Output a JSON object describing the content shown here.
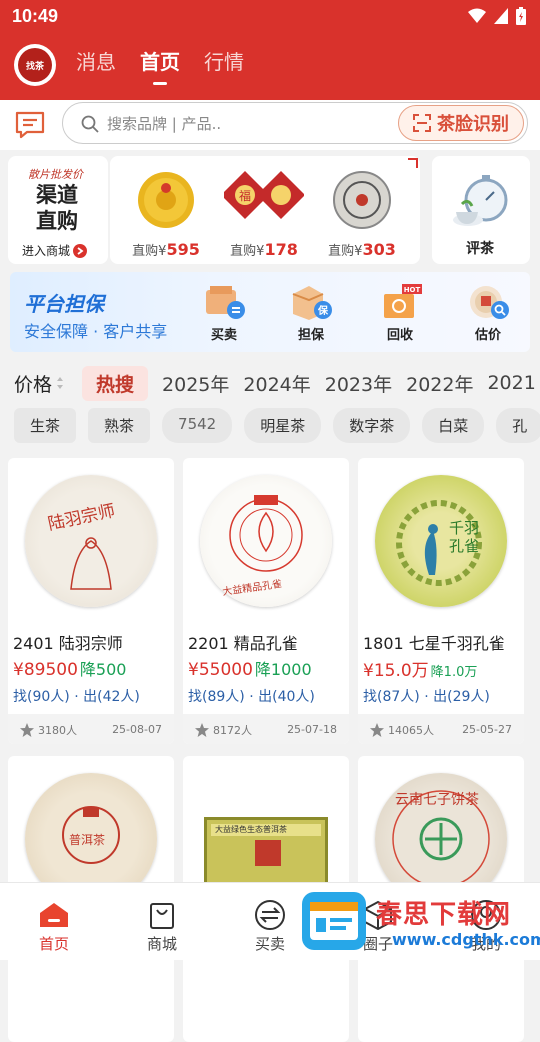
{
  "status": {
    "time": "10:49"
  },
  "header": {
    "logo_text": "找茶",
    "tabs": [
      {
        "label": "消息"
      },
      {
        "label": "首页"
      },
      {
        "label": "行情"
      }
    ],
    "active_tab": "首页"
  },
  "search": {
    "placeholder": "搜索品牌 | 产品..",
    "face_button": "茶脸识别"
  },
  "promos": {
    "wholesale_small": "散片批发价",
    "wholesale_big": "渠道直购",
    "enter_mall": "进入商城",
    "goods": [
      {
        "prefix": "直购",
        "currency": "¥",
        "price": "595"
      },
      {
        "prefix": "直购",
        "currency": "¥",
        "price": "178"
      },
      {
        "prefix": "直购",
        "currency": "¥",
        "price": "303"
      }
    ],
    "tea_review": "评茶"
  },
  "banner": {
    "title": "平台担保",
    "subtitle": "安全保障 · 客户共享",
    "hot_badge": "HOT",
    "items": [
      {
        "label": "买卖"
      },
      {
        "label": "担保"
      },
      {
        "label": "回收"
      },
      {
        "label": "估价"
      }
    ]
  },
  "filter": {
    "price_label": "价格",
    "hot": "热搜",
    "years": [
      "2025年",
      "2024年",
      "2023年",
      "2022年",
      "2021"
    ]
  },
  "tags": [
    "生茶",
    "熟茶",
    "7542",
    "明星茶",
    "数字茶",
    "白菜",
    "孔"
  ],
  "products": [
    {
      "title": "2401 陆羽宗师",
      "price": "¥89500",
      "drop": "降500",
      "find": "找(90人)",
      "sell": "出(42人)",
      "views": "3180人",
      "date": "25-08-07",
      "cake_text": "陆羽宗师"
    },
    {
      "title": "2201 精品孔雀",
      "price": "¥55000",
      "drop": "降1000",
      "find": "找(89人)",
      "sell": "出(40人)",
      "views": "8172人",
      "date": "25-07-18",
      "cake_text": "大益精品孔雀"
    },
    {
      "title": "1801 七星千羽孔雀",
      "price": "¥15.0万",
      "drop": "降1.0万",
      "find": "找(87人)",
      "sell": "出(29人)",
      "views": "14065人",
      "date": "25-05-27",
      "cake_text": "千羽孔雀"
    },
    {
      "cake_text": "普洱茶"
    },
    {
      "cake_text": "大益绿色生态普洱茶"
    },
    {
      "cake_text": "云南七子饼茶"
    }
  ],
  "bottom_nav": [
    {
      "label": "首页"
    },
    {
      "label": "商城"
    },
    {
      "label": "买卖"
    },
    {
      "label": "圈子"
    },
    {
      "label": "我的"
    }
  ],
  "watermark": {
    "text": "春思下载网",
    "url": "www.cdgthk.com"
  },
  "colors": {
    "brand": "#d9322c",
    "drop": "#1aa055",
    "link": "#2c5fa6"
  }
}
